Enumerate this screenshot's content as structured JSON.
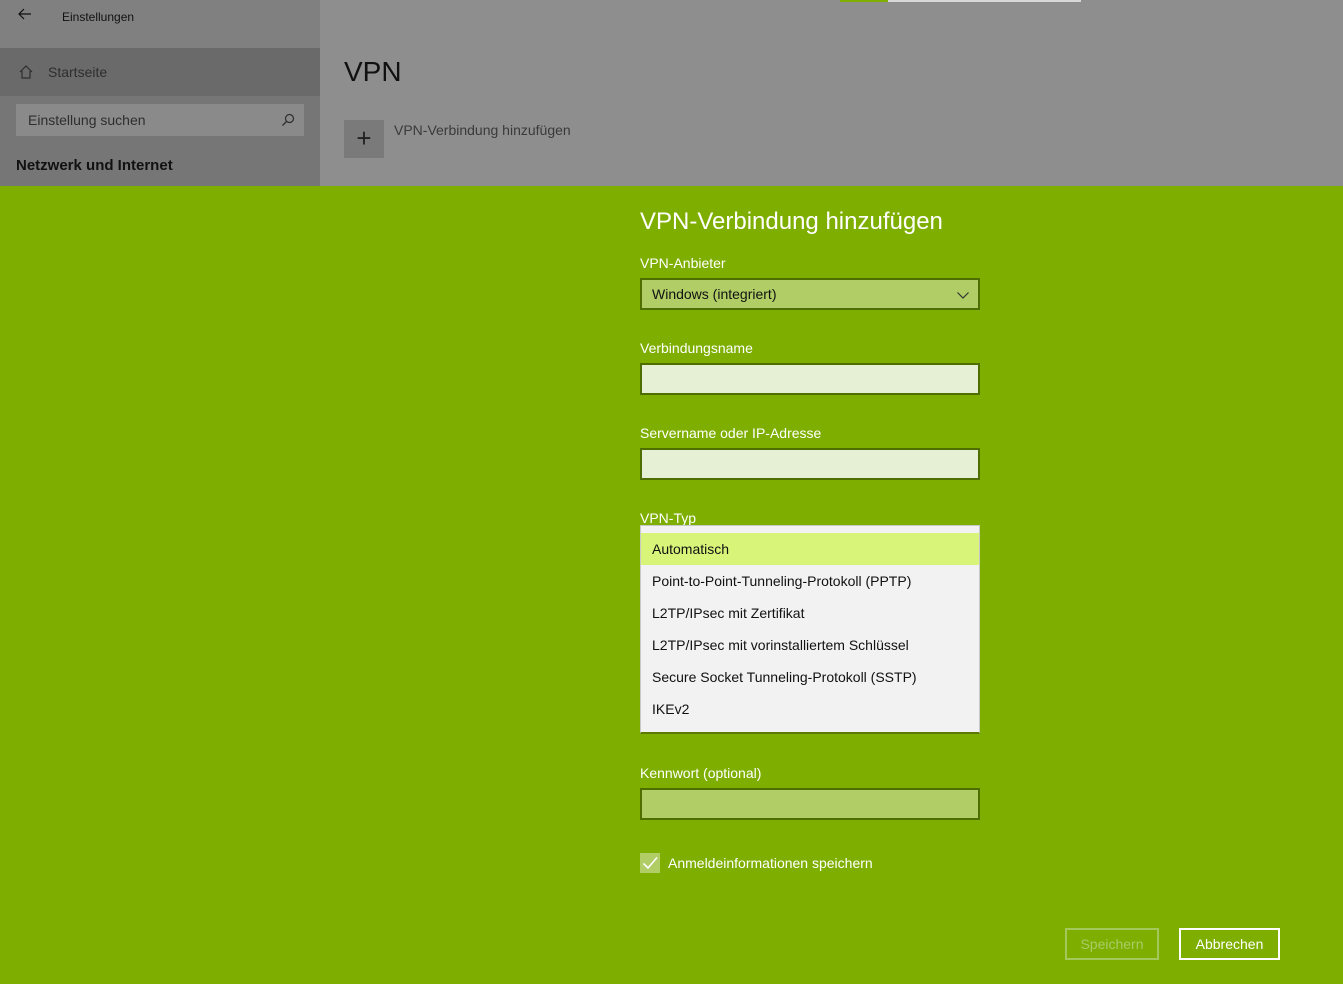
{
  "app": {
    "title": "Einstellungen"
  },
  "sidebar": {
    "home_label": "Startseite",
    "search_placeholder": "Einstellung suchen",
    "section_title": "Netzwerk und Internet"
  },
  "page": {
    "title": "VPN",
    "add_vpn_label": "VPN-Verbindung hinzufügen",
    "progress_fraction": 0.2
  },
  "dialog": {
    "title": "VPN-Verbindung hinzufügen",
    "provider": {
      "label": "VPN-Anbieter",
      "value": "Windows (integriert)"
    },
    "connection_name": {
      "label": "Verbindungsname",
      "value": ""
    },
    "server": {
      "label": "Servername oder IP-Adresse",
      "value": ""
    },
    "vpn_type": {
      "label": "VPN-Typ",
      "options": [
        "Automatisch",
        "Point-to-Point-Tunneling-Protokoll (PPTP)",
        "L2TP/IPsec mit Zertifikat",
        "L2TP/IPsec mit vorinstalliertem Schlüssel",
        "Secure Socket Tunneling-Protokoll (SSTP)",
        "IKEv2"
      ],
      "selected_index": 0
    },
    "password": {
      "label": "Kennwort (optional)",
      "value": ""
    },
    "remember_credentials": {
      "label": "Anmeldeinformationen speichern",
      "checked": true
    },
    "save_label": "Speichern",
    "cancel_label": "Abbrechen"
  },
  "colors": {
    "accent": "#7eaf00",
    "dropdown_highlight": "#d8f57a"
  },
  "icons": [
    "back-arrow-icon",
    "home-icon",
    "search-icon",
    "plus-icon",
    "chevron-down-icon",
    "checkmark-icon"
  ]
}
